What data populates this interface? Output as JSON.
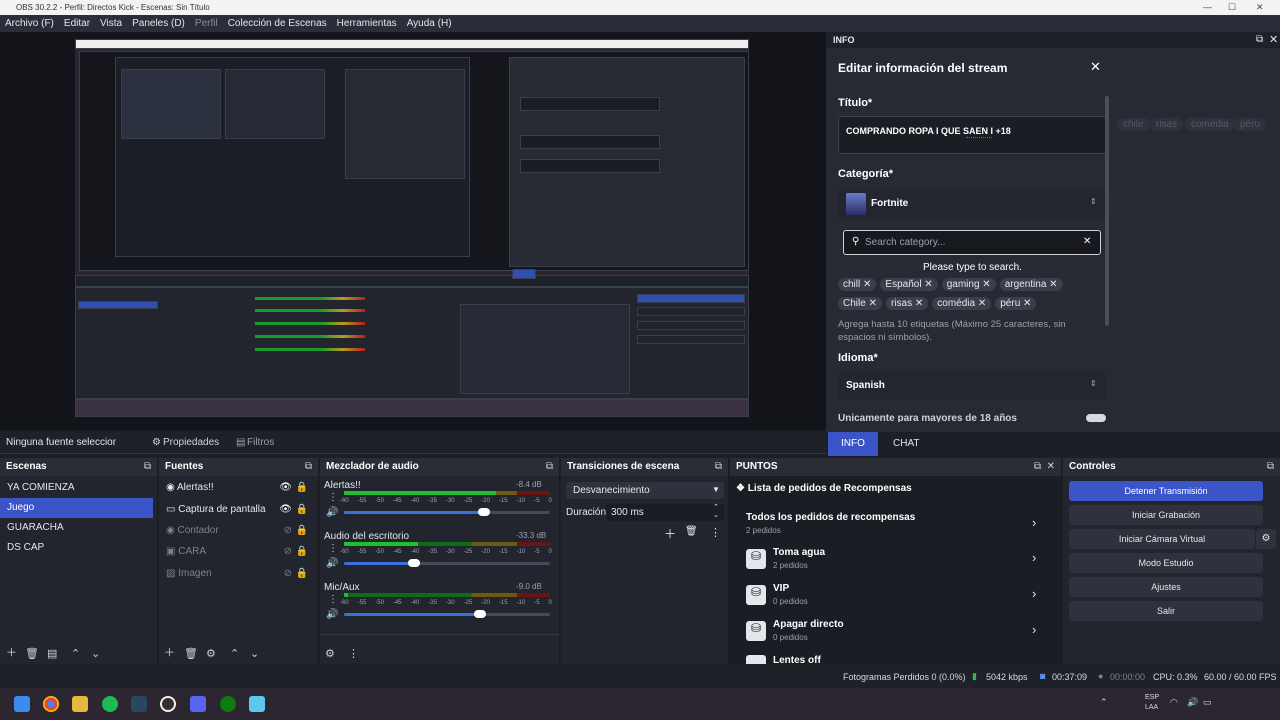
{
  "window": {
    "title": "OBS 30.2.2 - Perfil: Directos Kick - Escenas: Sin Título"
  },
  "menu": [
    "Archivo (F)",
    "Editar",
    "Vista",
    "Paneles (D)",
    "Perfil",
    "Colección de Escenas",
    "Herramientas",
    "Ayuda (H)"
  ],
  "info_panel": {
    "dock_title": "INFO",
    "title": "Editar información del stream",
    "title_label": "Título*",
    "title_value": "COMPRANDO ROPA I QUE SAEN I +18",
    "category_label": "Categoría*",
    "category_value": "Fortnite",
    "search_placeholder": "Search category...",
    "search_hint": "Please type to search.",
    "tags": [
      "chill",
      "Español",
      "gaming",
      "argentina",
      "Chile",
      "risas",
      "comédia",
      "péru"
    ],
    "tags_help": "Agrega hasta 10 etiquetas (Máximo 25 caracteres, sin espacios ni símbolos).",
    "language_label": "Idioma*",
    "language_value": "Spanish",
    "cut_label": "Únicamente para mayores de 18 años",
    "ghost_tags": [
      "chile",
      "risas",
      "comédia",
      "péru"
    ]
  },
  "bottom_tabs": [
    "INFO",
    "CHAT"
  ],
  "source_toolbar": {
    "none": "Ninguna fuente seleccionada",
    "properties": "Propiedades",
    "filters": "Filtros"
  },
  "scenes": {
    "title": "Escenas",
    "items": [
      "YA COMIENZA",
      "Juego",
      "GUARACHA",
      "DS CAP"
    ],
    "selected": 1
  },
  "sources": {
    "title": "Fuentes",
    "items": [
      {
        "name": "Alertas!!",
        "icon": "browser-icon",
        "visible": true,
        "locked": false
      },
      {
        "name": "Captura de pantalla",
        "icon": "monitor-icon",
        "visible": true,
        "locked": false
      },
      {
        "name": "Contador",
        "icon": "browser-icon",
        "visible": false,
        "locked": false
      },
      {
        "name": "CARA",
        "icon": "camera-icon",
        "visible": false,
        "locked": false
      },
      {
        "name": "Imagen",
        "icon": "image-icon",
        "visible": false,
        "locked": false
      }
    ]
  },
  "mixer": {
    "title": "Mezclador de audio",
    "ticks": [
      "-60",
      "-55",
      "-50",
      "-45",
      "-40",
      "-35",
      "-30",
      "-25",
      "-20",
      "-15",
      "-10",
      "-5",
      "0"
    ],
    "channels": [
      {
        "name": "Alertas!!",
        "db": "-8.4 dB",
        "level": 0.74,
        "volume": 0.68
      },
      {
        "name": "Audio del escritorio",
        "db": "-33.3 dB",
        "level": 0.36,
        "volume": 0.34
      },
      {
        "name": "Mic/Aux",
        "db": "-9.0 dB",
        "level": 0.02,
        "volume": 0.66
      }
    ]
  },
  "transitions": {
    "title": "Transiciones de escena",
    "selected": "Desvanecimiento",
    "duration_label": "Duración",
    "duration_value": "300 ms"
  },
  "puntos": {
    "title": "PUNTOS",
    "list_title": "Lista de pedidos de Recompensas",
    "items": [
      {
        "title": "Todos los pedidos de recompensas",
        "sub": "2 pedidos"
      },
      {
        "title": "Toma agua",
        "sub": "2 pedidos"
      },
      {
        "title": "VIP",
        "sub": "0 pedidos"
      },
      {
        "title": "Apagar directo",
        "sub": "0 pedidos"
      },
      {
        "title": "Lentes off",
        "sub": ""
      }
    ]
  },
  "controls": {
    "title": "Controles",
    "buttons": [
      "Detener Transmisión",
      "Iniciar Grabación",
      "Iniciar Cámara Virtual",
      "Modo Estudio",
      "Ajustes",
      "Salir"
    ]
  },
  "status": {
    "dropped": "Fotogramas Perdidos 0 (0.0%)",
    "bitrate": "5042 kbps",
    "stream_time": "00:37:09",
    "rec_time": "00:00:00",
    "cpu": "CPU: 0.3%",
    "fps": "60.00 / 60.00 FPS"
  },
  "tray": {
    "lang1": "ESP",
    "lang2": "LAA"
  },
  "colors": {
    "accent": "#3b55c9",
    "panel": "#22252d",
    "background": "#1d1f26"
  }
}
